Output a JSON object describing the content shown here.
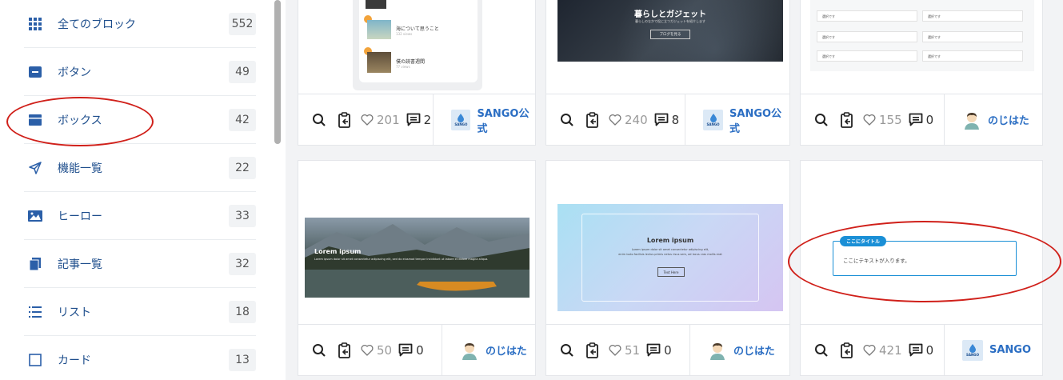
{
  "sidebar": {
    "items": [
      {
        "label": "全てのブロック",
        "count": "552",
        "icon": "grid-icon"
      },
      {
        "label": "ボタン",
        "count": "49",
        "icon": "button-icon"
      },
      {
        "label": "ボックス",
        "count": "42",
        "icon": "box-icon"
      },
      {
        "label": "機能一覧",
        "count": "22",
        "icon": "paper-plane-icon"
      },
      {
        "label": "ヒーロー",
        "count": "33",
        "icon": "image-icon"
      },
      {
        "label": "記事一覧",
        "count": "32",
        "icon": "documents-icon"
      },
      {
        "label": "リスト",
        "count": "18",
        "icon": "list-icon"
      },
      {
        "label": "カード",
        "count": "13",
        "icon": "card-icon"
      }
    ]
  },
  "cards": [
    {
      "likes": "201",
      "comments": "2",
      "author": "SANGO公式",
      "author_type": "sango",
      "preview": {
        "item1": "海について思うこと",
        "item1_sub": "132 views",
        "item2": "僕の読書週間",
        "item2_sub": "77 views"
      }
    },
    {
      "likes": "240",
      "comments": "8",
      "author": "SANGO公式",
      "author_type": "sango",
      "preview": {
        "title": "暮らしとガジェット",
        "sub": "暮らしのなかで役に立つガジェットを紹介します",
        "button": "ブログを見る"
      }
    },
    {
      "likes": "155",
      "comments": "0",
      "author": "のじはた",
      "author_type": "avatar",
      "preview": {
        "select_label": "選択です"
      }
    },
    {
      "likes": "50",
      "comments": "0",
      "author": "のじはた",
      "author_type": "avatar",
      "preview": {
        "title": "Lorem ipsum",
        "body": "Lorem ipsum dolor sit amet consectetur adipiscing elit, sed do eiusmod tempor incididunt ut labore et dolore magna aliqua."
      }
    },
    {
      "likes": "51",
      "comments": "0",
      "author": "のじはた",
      "author_type": "avatar",
      "preview": {
        "title": "Lorem ipsum",
        "body1": "Lorem ipsum dolor sit amet consectetur adipiscing elit,",
        "body2": "enim iusto facilisis lectus primis netus risus sem, ad lacus cras mollis erat",
        "button": "Text Here"
      }
    },
    {
      "likes": "421",
      "comments": "0",
      "author": "SANGO",
      "author_type": "sango",
      "preview": {
        "box_title": "ここにタイトル",
        "box_text": "ここにテキストが入ります。"
      }
    }
  ],
  "badge": {
    "text": "SANGO"
  },
  "colors": {
    "accent": "#2b6ec3",
    "sidebar_label": "#1e4e8c",
    "highlight_oval": "#d0201a",
    "box_blue": "#1a8fd6"
  }
}
